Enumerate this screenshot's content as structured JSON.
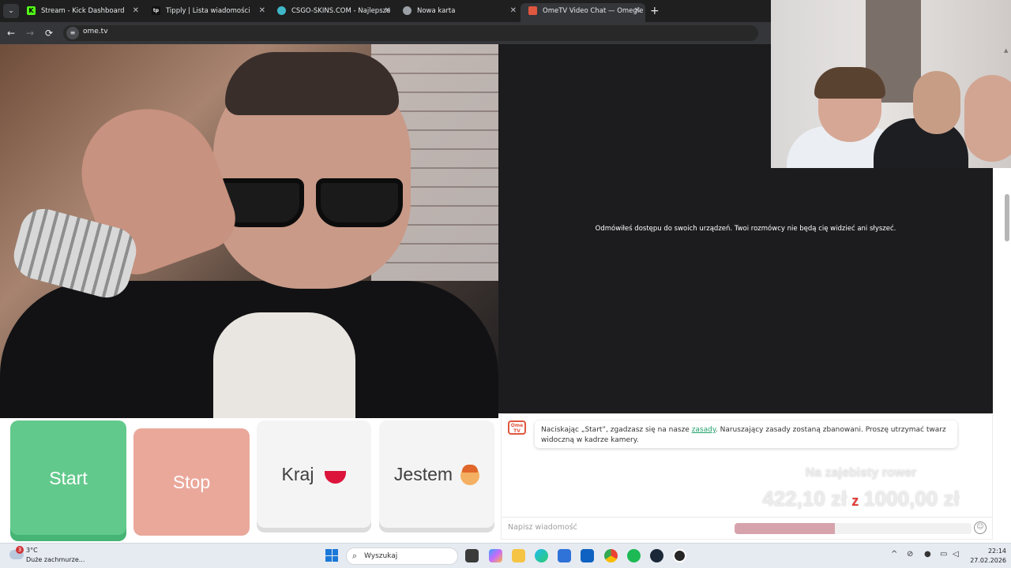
{
  "browser": {
    "tabs": [
      {
        "label": "Stream - Kick Dashboard",
        "icon": "kick-icon",
        "active": false
      },
      {
        "label": "Tipply | Lista wiadomości",
        "icon": "tipply-icon",
        "active": false
      },
      {
        "label": "CSGO-SKINS.COM - Najlepsze",
        "icon": "csgo-skins-icon",
        "active": false
      },
      {
        "label": "Nowa karta",
        "icon": "chrome-icon",
        "active": false
      },
      {
        "label": "OmeTV Video Chat — Omegle",
        "icon": "ometv-icon",
        "active": true
      }
    ],
    "tab_close_glyph": "✕",
    "tab_list_glyph": "⌄",
    "new_tab_glyph": "+",
    "url": "ome.tv",
    "nav": {
      "back": "←",
      "forward": "→",
      "reload": "⟳"
    }
  },
  "ometv": {
    "notice": "Odmówiłeś dostępu do swoich urządzeń. Twoi rozmówcy nie będą cię widzieć ani słyszeć.",
    "buttons": {
      "start": "Start",
      "stop": "Stop",
      "country": "Kraj",
      "gender": "Jestem"
    },
    "chat": {
      "logo_text": "Ome TV",
      "message_before_link": "Naciskając „Start”, zgadzasz się na nasze ",
      "message_link": "zasady",
      "message_after_link": ". Naruszający zasady zostaną zbanowani. Proszę utrzymać twarz widoczną w kadrze kamery.",
      "input_placeholder": "Napisz wiadomość",
      "emoji_glyph": "☺"
    },
    "goal": {
      "title": "Na zajebisty rower",
      "current": "422,10 zł",
      "separator": "z",
      "target": "1000,00 zł",
      "progress_fraction": 0.4221
    },
    "colors": {
      "start": "#62c98c",
      "stop": "#eaa89b",
      "accent": "#e0573f",
      "link": "#22a06b"
    }
  },
  "taskbar": {
    "weather": {
      "badge": "3",
      "temp": "3°C",
      "condition": "Duże zachmurze..."
    },
    "search_placeholder": "Wyszukaj",
    "apps": [
      "task-view-icon",
      "copilot-icon",
      "file-explorer-icon",
      "edge-icon",
      "store-icon",
      "outlook-icon",
      "chrome-icon",
      "spotify-icon",
      "steam-icon",
      "obs-icon"
    ],
    "tray": {
      "chevron": "^"
    },
    "time": "22:14",
    "date": "27.02.2026"
  }
}
